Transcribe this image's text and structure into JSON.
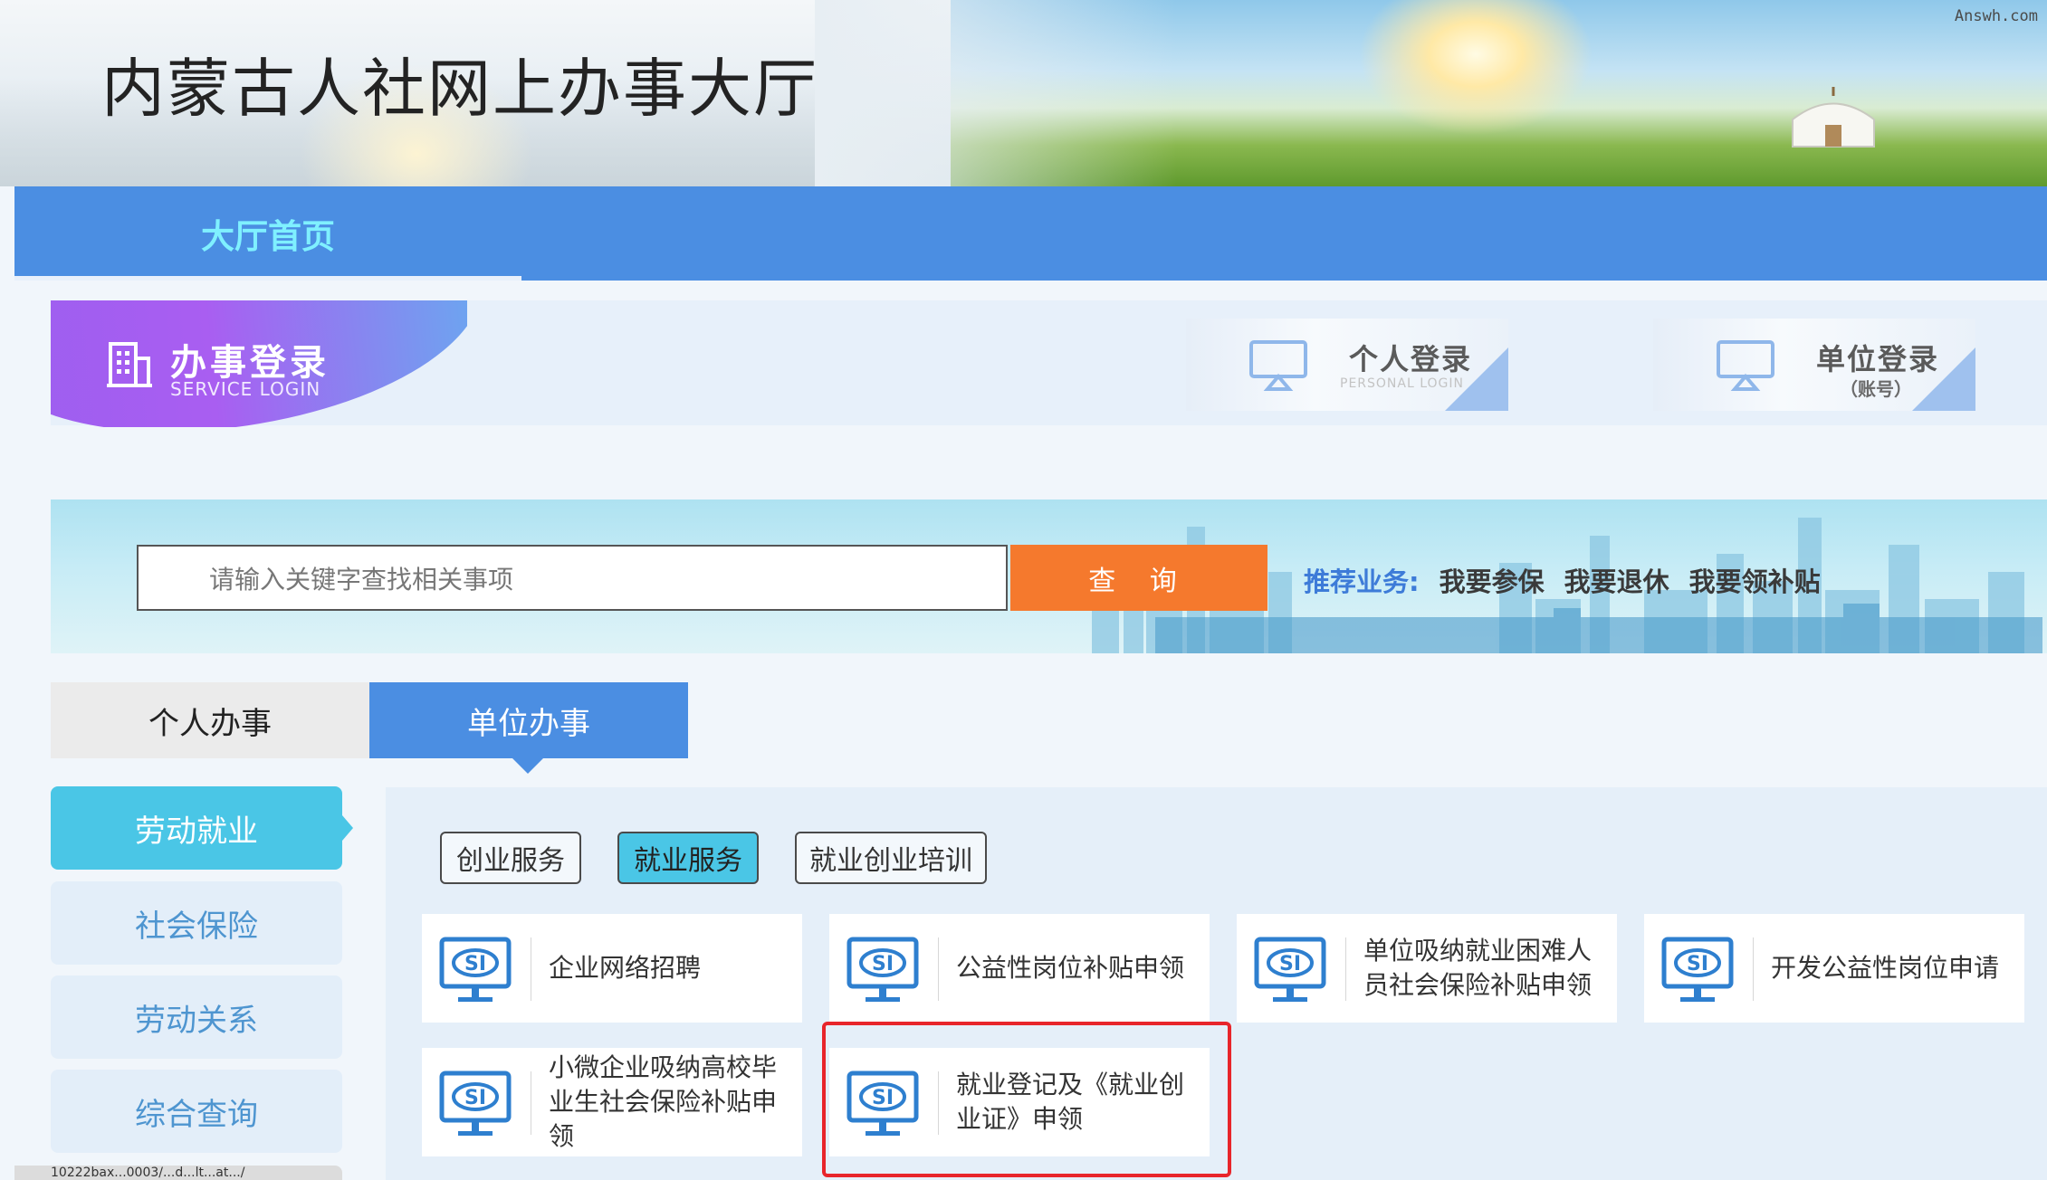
{
  "header": {
    "site_title": "内蒙古人社网上办事大厅",
    "watermark": "Answh.com"
  },
  "nav": {
    "home_label": "大厅首页"
  },
  "service_login": {
    "title": "办事登录",
    "subtitle": "SERVICE LOGIN"
  },
  "login_buttons": {
    "personal": {
      "label": "个人登录",
      "sub": "PERSONAL LOGIN"
    },
    "unit": {
      "label": "单位登录",
      "sub": "（账号）"
    }
  },
  "search": {
    "placeholder": "请输入关键字查找相关事项",
    "button_label": "查 询",
    "recommend_label": "推荐业务:",
    "recommend_links": [
      "我要参保",
      "我要退休",
      "我要领补贴"
    ]
  },
  "tabs": [
    "个人办事",
    "单位办事"
  ],
  "active_tab": "单位办事",
  "side_menu": [
    "劳动就业",
    "社会保险",
    "劳动关系",
    "综合查询"
  ],
  "active_side": "劳动就业",
  "categories": [
    "创业服务",
    "就业服务",
    "就业创业培训"
  ],
  "active_category": "就业服务",
  "services": [
    "企业网络招聘",
    "公益性岗位补贴申领",
    "单位吸纳就业困难人员社会保险补贴申领",
    "开发公益性岗位申请",
    "小微企业吸纳高校毕业生社会保险补贴申领",
    "就业登记及《就业创业证》申领"
  ],
  "highlighted_service": "就业登记及《就业创业证》申领",
  "status_url": "10222bax...0003/...d...lt...at.../",
  "colors": {
    "nav_blue": "#4b8ee2",
    "accent_cyan": "#4ac6e6",
    "search_orange": "#f5792d",
    "highlight_red": "#e8252b"
  }
}
